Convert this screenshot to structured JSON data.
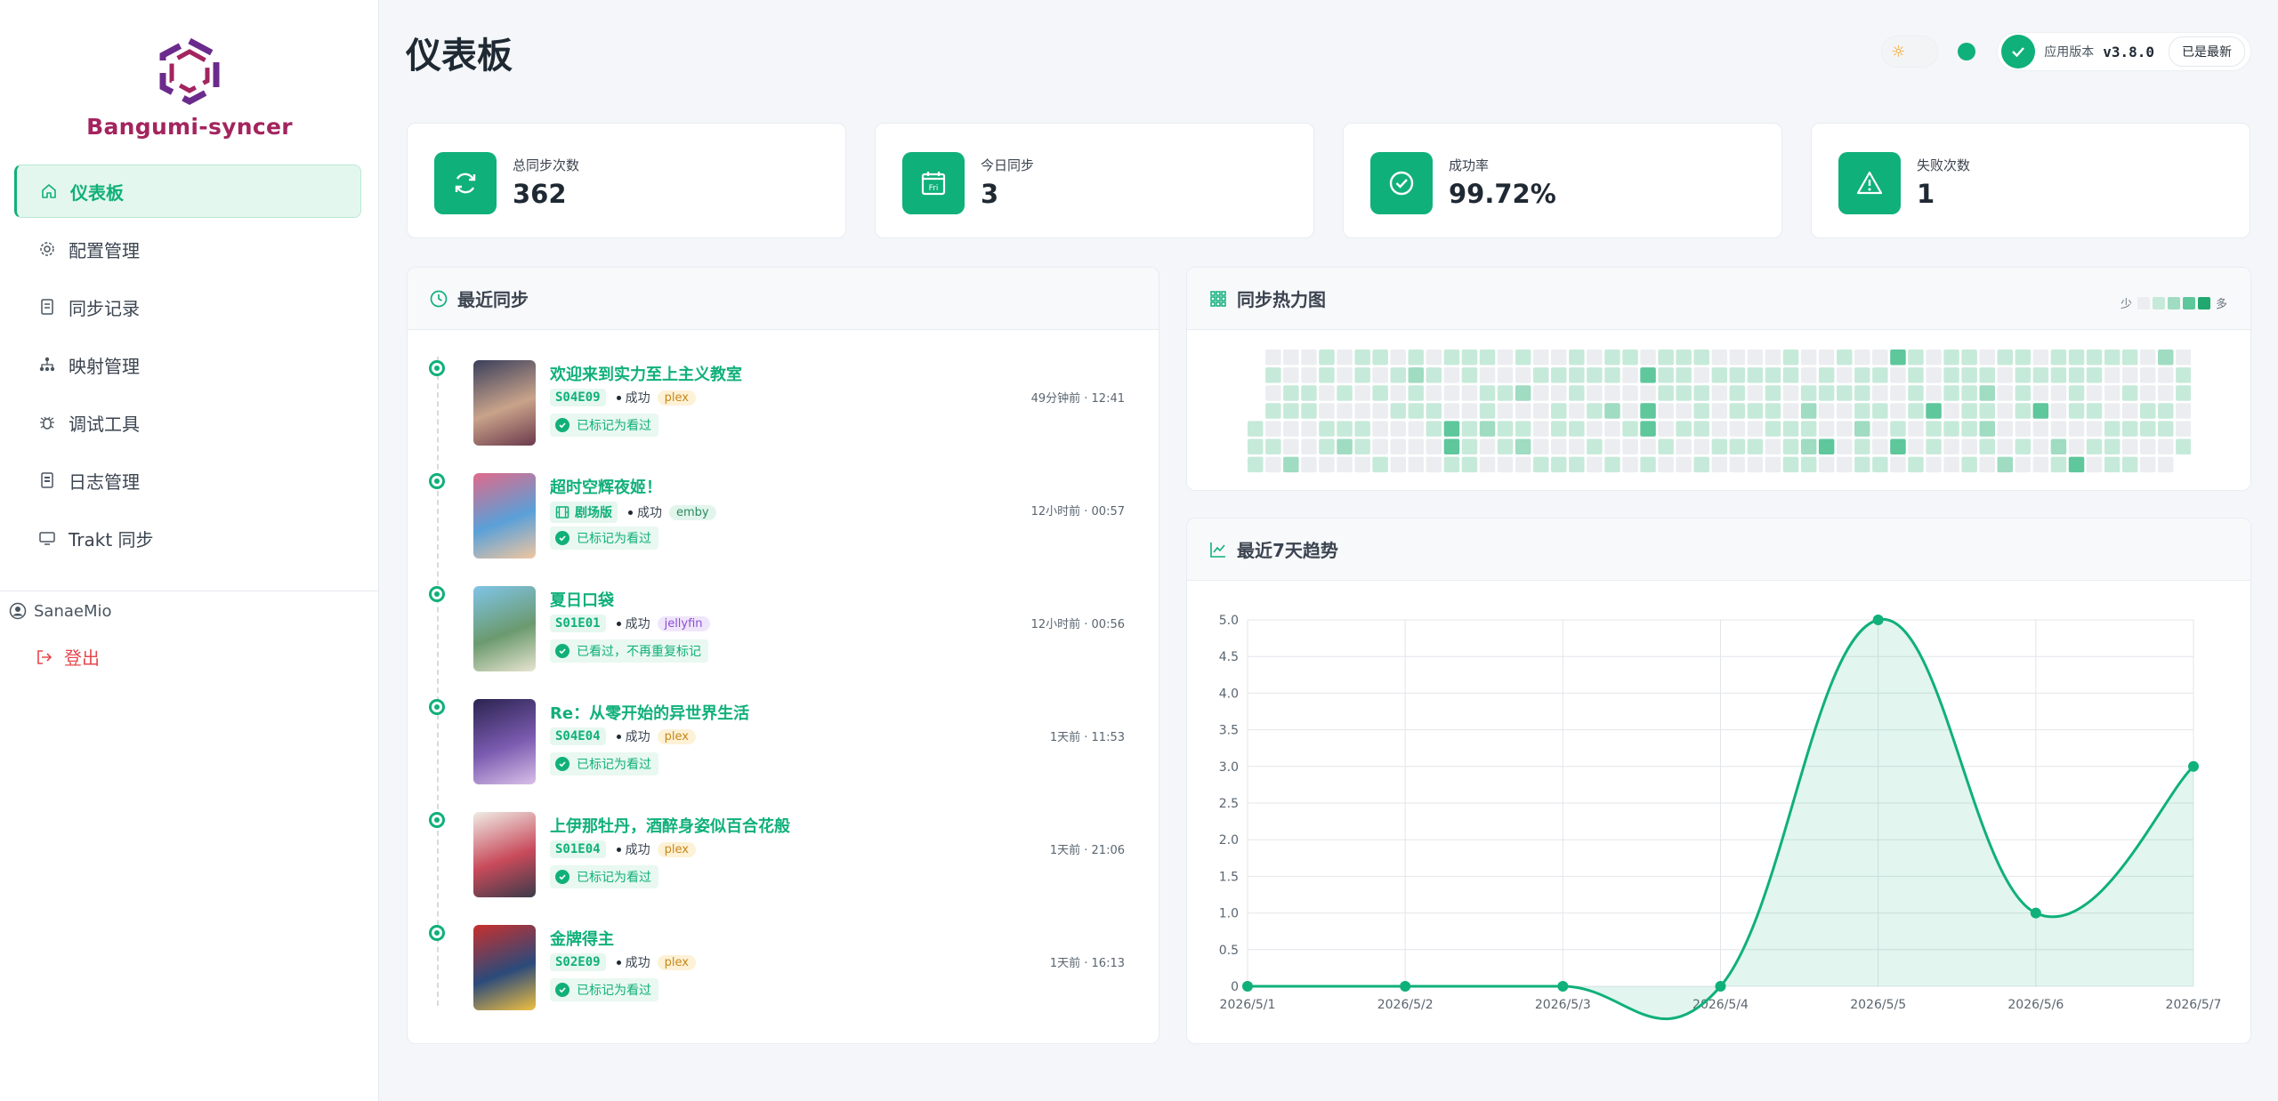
{
  "app": {
    "name": "Bangumi-syncer",
    "brand_color": "#a3245e",
    "accent_color": "#10b07a"
  },
  "sidebar": {
    "items": [
      {
        "label": "仪表板",
        "icon": "home-icon",
        "active": true
      },
      {
        "label": "配置管理",
        "icon": "gear-icon",
        "active": false
      },
      {
        "label": "同步记录",
        "icon": "document-icon",
        "active": false
      },
      {
        "label": "映射管理",
        "icon": "sitemap-icon",
        "active": false
      },
      {
        "label": "调试工具",
        "icon": "bug-icon",
        "active": false
      },
      {
        "label": "日志管理",
        "icon": "log-icon",
        "active": false
      },
      {
        "label": "Trakt 同步",
        "icon": "monitor-icon",
        "active": false
      }
    ],
    "user": "SanaeMio",
    "logout_label": "登出"
  },
  "header": {
    "title": "仪表板",
    "version_label": "应用版本",
    "version_value": "v3.8.0",
    "version_status": "已是最新",
    "theme_icon": "sun-icon"
  },
  "stats": [
    {
      "label": "总同步次数",
      "value": "362",
      "icon": "refresh-icon"
    },
    {
      "label": "今日同步",
      "value": "3",
      "icon": "calendar-icon",
      "icon_text": "Fri"
    },
    {
      "label": "成功率",
      "value": "99.72%",
      "icon": "check-circle-icon"
    },
    {
      "label": "失败次数",
      "value": "1",
      "icon": "warning-icon"
    }
  ],
  "recent": {
    "title": "最近同步",
    "items": [
      {
        "title": "欢迎来到实力至上主义教室",
        "episode": "S04E09",
        "movie": false,
        "status": "成功",
        "source": "plex",
        "result": "已标记为看过",
        "time": "49分钟前 · 12:41",
        "poster_colors": [
          "#3a3f5c",
          "#c9a38a",
          "#6b3a4c"
        ]
      },
      {
        "title": "超时空辉夜姬！",
        "episode": "剧场版",
        "movie": true,
        "status": "成功",
        "source": "emby",
        "result": "已标记为看过",
        "time": "12小时前 · 00:57",
        "poster_colors": [
          "#e06a8a",
          "#5aa0d8",
          "#f2c6a0"
        ]
      },
      {
        "title": "夏日口袋",
        "episode": "S01E01",
        "movie": false,
        "status": "成功",
        "source": "jellyfin",
        "result": "已看过，不再重复标记",
        "time": "12小时前 · 00:56",
        "poster_colors": [
          "#7fc4e8",
          "#6b9a6e",
          "#e8e4d0"
        ]
      },
      {
        "title": "Re：从零开始的异世界生活",
        "episode": "S04E04",
        "movie": false,
        "status": "成功",
        "source": "plex",
        "result": "已标记为看过",
        "time": "1天前 · 11:53",
        "poster_colors": [
          "#2a2350",
          "#7b5bb0",
          "#d8c0e8"
        ]
      },
      {
        "title": "上伊那牡丹，酒醉身姿似百合花般",
        "episode": "S01E04",
        "movie": false,
        "status": "成功",
        "source": "plex",
        "result": "已标记为看过",
        "time": "1天前 · 21:06",
        "poster_colors": [
          "#f0ece6",
          "#c84a5a",
          "#3b3b4a"
        ]
      },
      {
        "title": "金牌得主",
        "episode": "S02E09",
        "movie": false,
        "status": "成功",
        "source": "plex",
        "result": "已标记为看过",
        "time": "1天前 · 16:13",
        "poster_colors": [
          "#c8302e",
          "#2b4a7a",
          "#f0c040"
        ]
      }
    ]
  },
  "heatmap": {
    "title": "同步热力图",
    "legend_less": "少",
    "legend_more": "多",
    "scale_colors": [
      "#ebedf0",
      "#c6ead9",
      "#9fdcc1",
      "#5ec79c",
      "#21a86f"
    ],
    "weeks": 52,
    "seed_levels": "0001111010101000110020011000110011000101201100110101000101010001211000010110010003311100111101120000101101020120010000101011011110101010101011020011000100030330111100101110100101110101000100111010010101001111001100111001212101100301010000011121101010013000130111100100031101110100111110101212101000002111101001030001100021111100311010101"
  },
  "trend": {
    "title": "最近7天趋势",
    "chart_data": {
      "type": "area",
      "x": [
        "2026/5/1",
        "2026/5/2",
        "2026/5/3",
        "2026/5/4",
        "2026/5/5",
        "2026/5/6",
        "2026/5/7"
      ],
      "values": [
        0,
        0,
        0,
        0,
        5,
        1,
        3
      ],
      "ylim": [
        0,
        5
      ],
      "yticks": [
        "0",
        "0.5",
        "1.0",
        "1.5",
        "2.0",
        "2.5",
        "3.0",
        "3.5",
        "4.0",
        "4.5",
        "5.0"
      ],
      "grid": true,
      "color": "#10b07a"
    }
  }
}
